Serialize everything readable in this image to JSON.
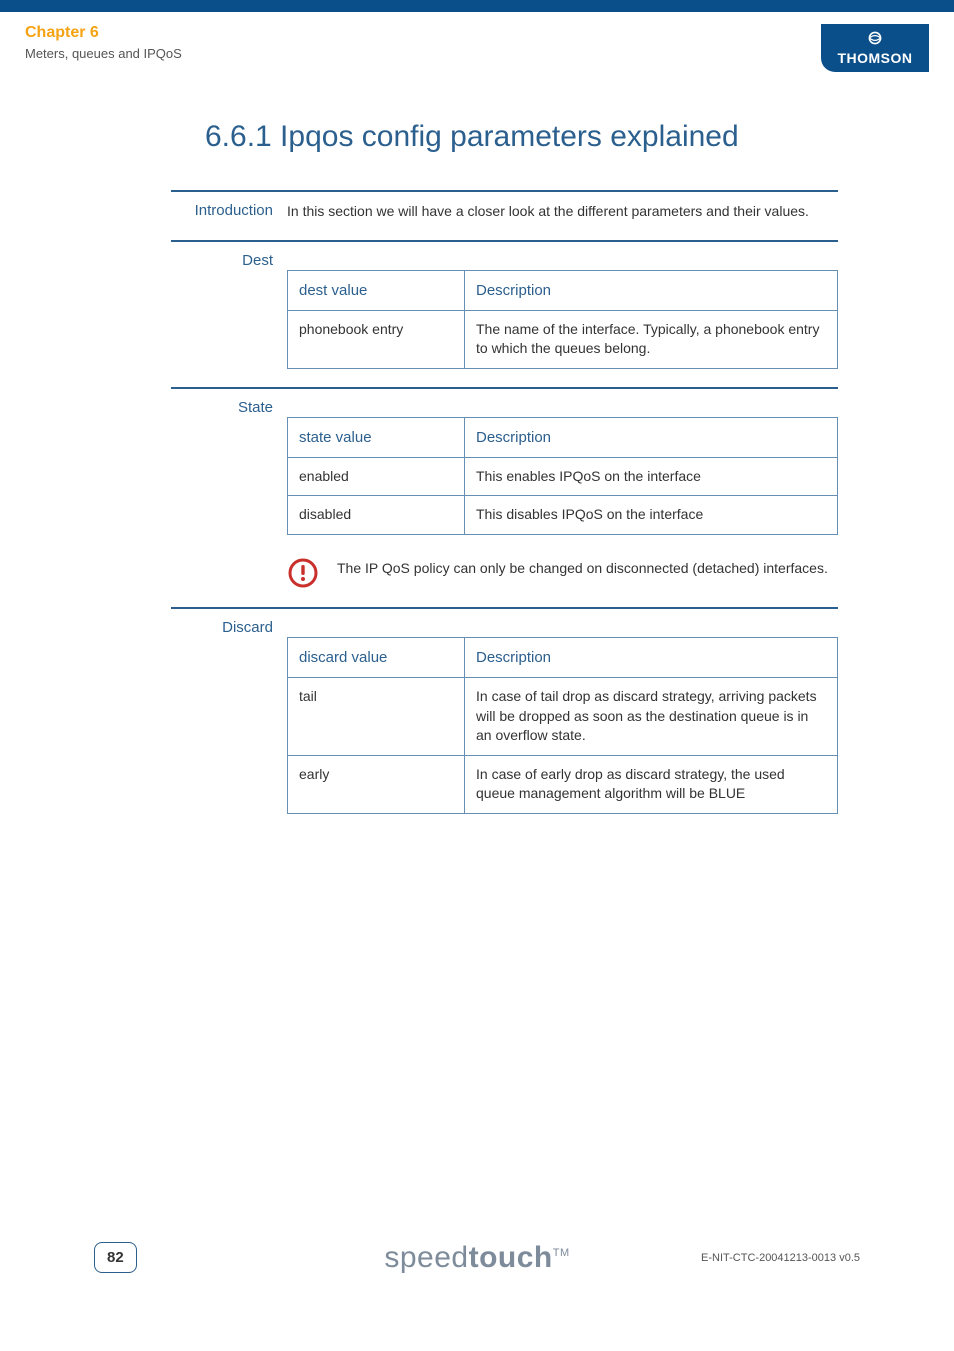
{
  "header": {
    "chapter": "Chapter 6",
    "subtitle": "Meters, queues and IPQoS",
    "logo_text": "THOMSON"
  },
  "title": "6.6.1  Ipqos config parameters explained",
  "sections": {
    "intro": {
      "label": "Introduction",
      "text": "In this section we will have a closer look at the different parameters and their values."
    },
    "dest": {
      "label": "Dest",
      "th1": "dest value",
      "th2": "Description",
      "rows": [
        {
          "v": "phonebook entry",
          "d": "The name of the interface. Typically, a phonebook entry to which the queues belong."
        }
      ]
    },
    "state": {
      "label": "State",
      "th1": "state value",
      "th2": "Description",
      "rows": [
        {
          "v": "enabled",
          "d": "This enables IPQoS on the interface"
        },
        {
          "v": "disabled",
          "d": "This disables IPQoS on the interface"
        }
      ],
      "note": "The IP QoS policy can only be changed on disconnected (detached) interfaces."
    },
    "discard": {
      "label": "Discard",
      "th1": "discard value",
      "th2": "Description",
      "rows": [
        {
          "v": "tail",
          "d": "In case of tail drop as discard strategy, arriving packets will be dropped as soon as the destination queue is in an overflow state."
        },
        {
          "v": "early",
          "d": "In case of early drop as discard strategy, the used queue management algorithm will be BLUE"
        }
      ]
    }
  },
  "footer": {
    "page": "82",
    "brand_light": "speed",
    "brand_bold": "touch",
    "tm": "TM",
    "docid": "E-NIT-CTC-20041213-0013 v0.5"
  }
}
